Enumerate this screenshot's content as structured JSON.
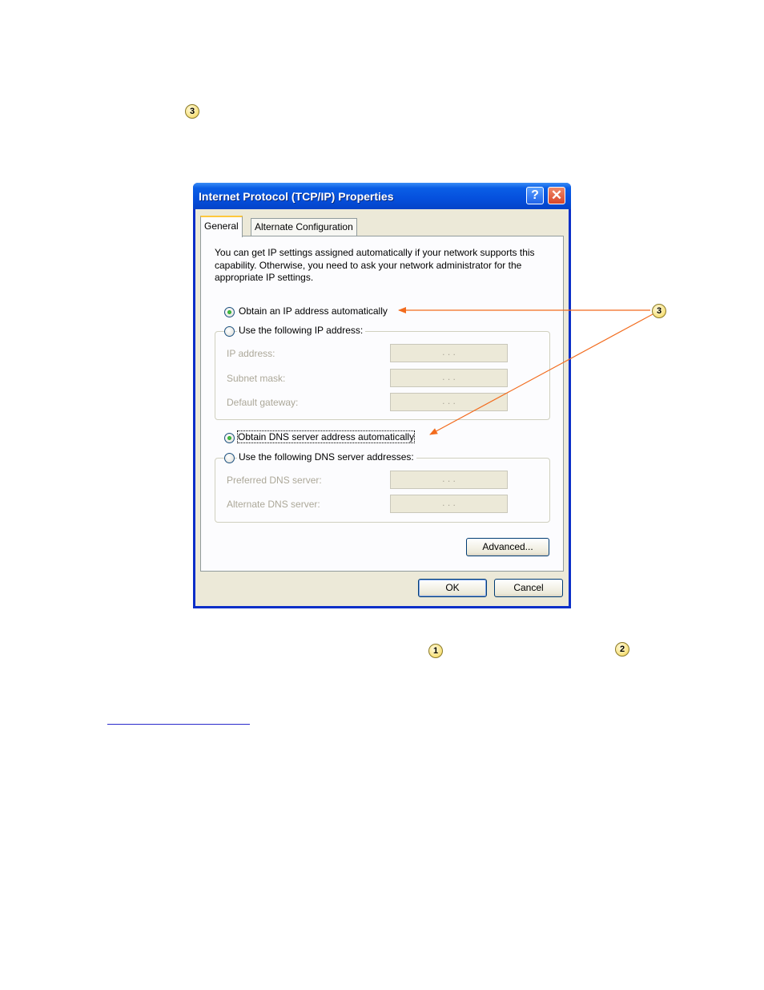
{
  "callouts": {
    "top": "3",
    "right": "3",
    "bottom_left": "1",
    "bottom_right": "2"
  },
  "dialog": {
    "title": "Internet Protocol (TCP/IP) Properties",
    "help_glyph": "?",
    "close_glyph": "✕",
    "tabs": {
      "general": "General",
      "alternate": "Alternate Configuration"
    },
    "description": "You can get IP settings assigned automatically if your network supports this capability. Otherwise, you need to ask your network administrator for the appropriate IP settings.",
    "ip": {
      "obtain_auto": "Obtain an IP address automatically",
      "use_following": "Use the following IP address:",
      "ip_address_label": "IP address:",
      "subnet_mask_label": "Subnet mask:",
      "default_gateway_label": "Default gateway:",
      "empty_value": ".      .      ."
    },
    "dns": {
      "obtain_auto": "Obtain DNS server address automatically",
      "use_following": "Use the following DNS server addresses:",
      "preferred_label": "Preferred DNS server:",
      "alternate_label": "Alternate DNS server:"
    },
    "buttons": {
      "advanced": "Advanced...",
      "ok": "OK",
      "cancel": "Cancel"
    }
  },
  "colors": {
    "arrow": "#f26b1d",
    "title_bar": "#0550dd",
    "dialog_bg": "#ece9d8"
  }
}
